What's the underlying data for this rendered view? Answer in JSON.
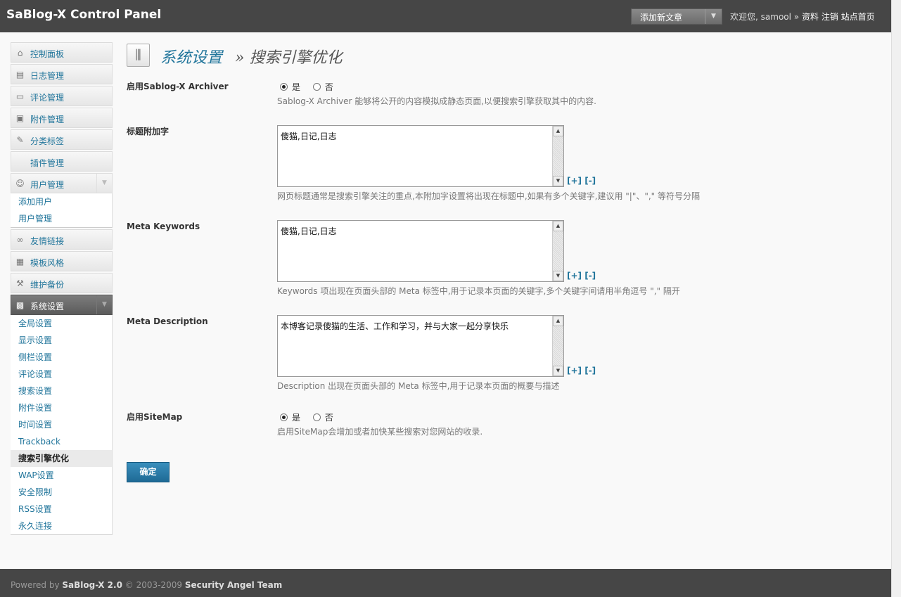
{
  "header": {
    "title": "SaBlog-X Control Panel",
    "quick_action": "添加新文章",
    "welcome": "欢迎您,",
    "username": "samool",
    "sep": "»",
    "links": [
      "资料",
      "注销",
      "站点首页"
    ]
  },
  "sidebar": {
    "items": [
      {
        "label": "控制面板",
        "icon": "home-icon"
      },
      {
        "label": "日志管理",
        "icon": "document-icon"
      },
      {
        "label": "评论管理",
        "icon": "comment-icon"
      },
      {
        "label": "附件管理",
        "icon": "attachment-icon"
      },
      {
        "label": "分类标签",
        "icon": "pin-icon"
      },
      {
        "label": "插件管理",
        "icon": ""
      },
      {
        "label": "用户管理",
        "icon": "users-icon"
      },
      {
        "label": "友情链接",
        "icon": "link-icon"
      },
      {
        "label": "模板风格",
        "icon": "template-icon"
      },
      {
        "label": "维护备份",
        "icon": "tools-icon"
      },
      {
        "label": "系统设置",
        "icon": "settings-icon"
      }
    ],
    "user_sub": [
      "添加用户",
      "用户管理"
    ],
    "settings_sub": [
      "全局设置",
      "显示设置",
      "侧栏设置",
      "评论设置",
      "搜索设置",
      "附件设置",
      "时间设置",
      "Trackback",
      "搜索引擎优化",
      "WAP设置",
      "安全限制",
      "RSS设置",
      "永久连接"
    ]
  },
  "page": {
    "title_section": "系统设置",
    "title_sep": "»",
    "title_page": "搜索引擎优化"
  },
  "form": {
    "yes": "是",
    "no": "否",
    "archiver": {
      "label": "启用Sablog-X Archiver",
      "value": "是",
      "help": "Sablog-X Archiver 能够将公开的内容模拟成静态页面,以便搜索引擎获取其中的内容."
    },
    "title_append": {
      "label": "标题附加字",
      "value": "傻猫,日记,日志",
      "help": "网页标题通常是搜索引擎关注的重点,本附加字设置将出现在标题中,如果有多个关键字,建议用 \"|\"、\",\" 等符号分隔"
    },
    "keywords": {
      "label": "Meta Keywords",
      "value": "傻猫,日记,日志",
      "help": "Keywords 项出现在页面头部的 Meta 标签中,用于记录本页面的关键字,多个关键字间请用半角逗号 \",\" 隔开"
    },
    "description": {
      "label": "Meta Description",
      "value": "本博客记录傻猫的生活、工作和学习，并与大家一起分享快乐",
      "help": "Description 出现在页面头部的 Meta 标签中,用于记录本页面的概要与描述"
    },
    "sitemap": {
      "label": "启用SiteMap",
      "value": "是",
      "help": "启用SiteMap会增加或者加快某些搜索对您网站的收录."
    },
    "plus": "[+]",
    "minus": "[-]",
    "submit": "确定"
  },
  "footer": {
    "powered": "Powered by",
    "product": "SaBlog-X 2.0",
    "copyright": "© 2003-2009",
    "team": "Security Angel Team"
  }
}
